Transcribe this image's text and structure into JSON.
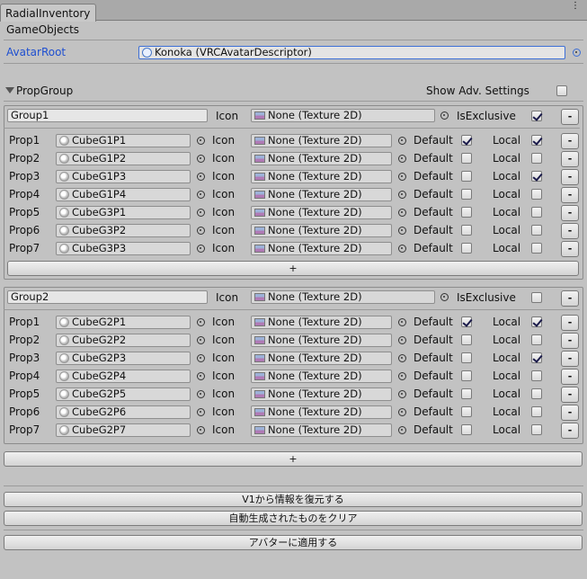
{
  "window": {
    "tab_title": "RadialInventory",
    "menu_icon": "kebab-menu-icon"
  },
  "section_title": "GameObjects",
  "avatar_root": {
    "label": "AvatarRoot",
    "value": "Konoka (VRCAvatarDescriptor)"
  },
  "prop_group": {
    "label": "PropGroup",
    "show_adv_label": "Show Adv. Settings",
    "show_adv_checked": false
  },
  "labels": {
    "icon": "Icon",
    "is_exclusive": "IsExclusive",
    "default": "Default",
    "local": "Local",
    "remove": "-",
    "add": "+"
  },
  "groups": [
    {
      "name": "Group1",
      "icon": "None (Texture 2D)",
      "is_exclusive": true,
      "props": [
        {
          "label": "Prop1",
          "object": "CubeG1P1",
          "icon": "None (Texture 2D)",
          "default": true,
          "local": true
        },
        {
          "label": "Prop2",
          "object": "CubeG1P2",
          "icon": "None (Texture 2D)",
          "default": false,
          "local": false
        },
        {
          "label": "Prop3",
          "object": "CubeG1P3",
          "icon": "None (Texture 2D)",
          "default": false,
          "local": true
        },
        {
          "label": "Prop4",
          "object": "CubeG1P4",
          "icon": "None (Texture 2D)",
          "default": false,
          "local": false
        },
        {
          "label": "Prop5",
          "object": "CubeG3P1",
          "icon": "None (Texture 2D)",
          "default": false,
          "local": false
        },
        {
          "label": "Prop6",
          "object": "CubeG3P2",
          "icon": "None (Texture 2D)",
          "default": false,
          "local": false
        },
        {
          "label": "Prop7",
          "object": "CubeG3P3",
          "icon": "None (Texture 2D)",
          "default": false,
          "local": false
        }
      ]
    },
    {
      "name": "Group2",
      "icon": "None (Texture 2D)",
      "is_exclusive": false,
      "props": [
        {
          "label": "Prop1",
          "object": "CubeG2P1",
          "icon": "None (Texture 2D)",
          "default": true,
          "local": true
        },
        {
          "label": "Prop2",
          "object": "CubeG2P2",
          "icon": "None (Texture 2D)",
          "default": false,
          "local": false
        },
        {
          "label": "Prop3",
          "object": "CubeG2P3",
          "icon": "None (Texture 2D)",
          "default": false,
          "local": true
        },
        {
          "label": "Prop4",
          "object": "CubeG2P4",
          "icon": "None (Texture 2D)",
          "default": false,
          "local": false
        },
        {
          "label": "Prop5",
          "object": "CubeG2P5",
          "icon": "None (Texture 2D)",
          "default": false,
          "local": false
        },
        {
          "label": "Prop6",
          "object": "CubeG2P6",
          "icon": "None (Texture 2D)",
          "default": false,
          "local": false
        },
        {
          "label": "Prop7",
          "object": "CubeG2P7",
          "icon": "None (Texture 2D)",
          "default": false,
          "local": false
        }
      ]
    }
  ],
  "buttons": {
    "restore_v1": "V1から情報を復元する",
    "clear_generated": "自動生成されたものをクリア",
    "apply_to_avatar": "アバターに適用する"
  },
  "colors": {
    "avatar_root_label": "#1e4fd0",
    "avatar_field_border": "#3d6fd6",
    "background": "#c2c2c2"
  }
}
